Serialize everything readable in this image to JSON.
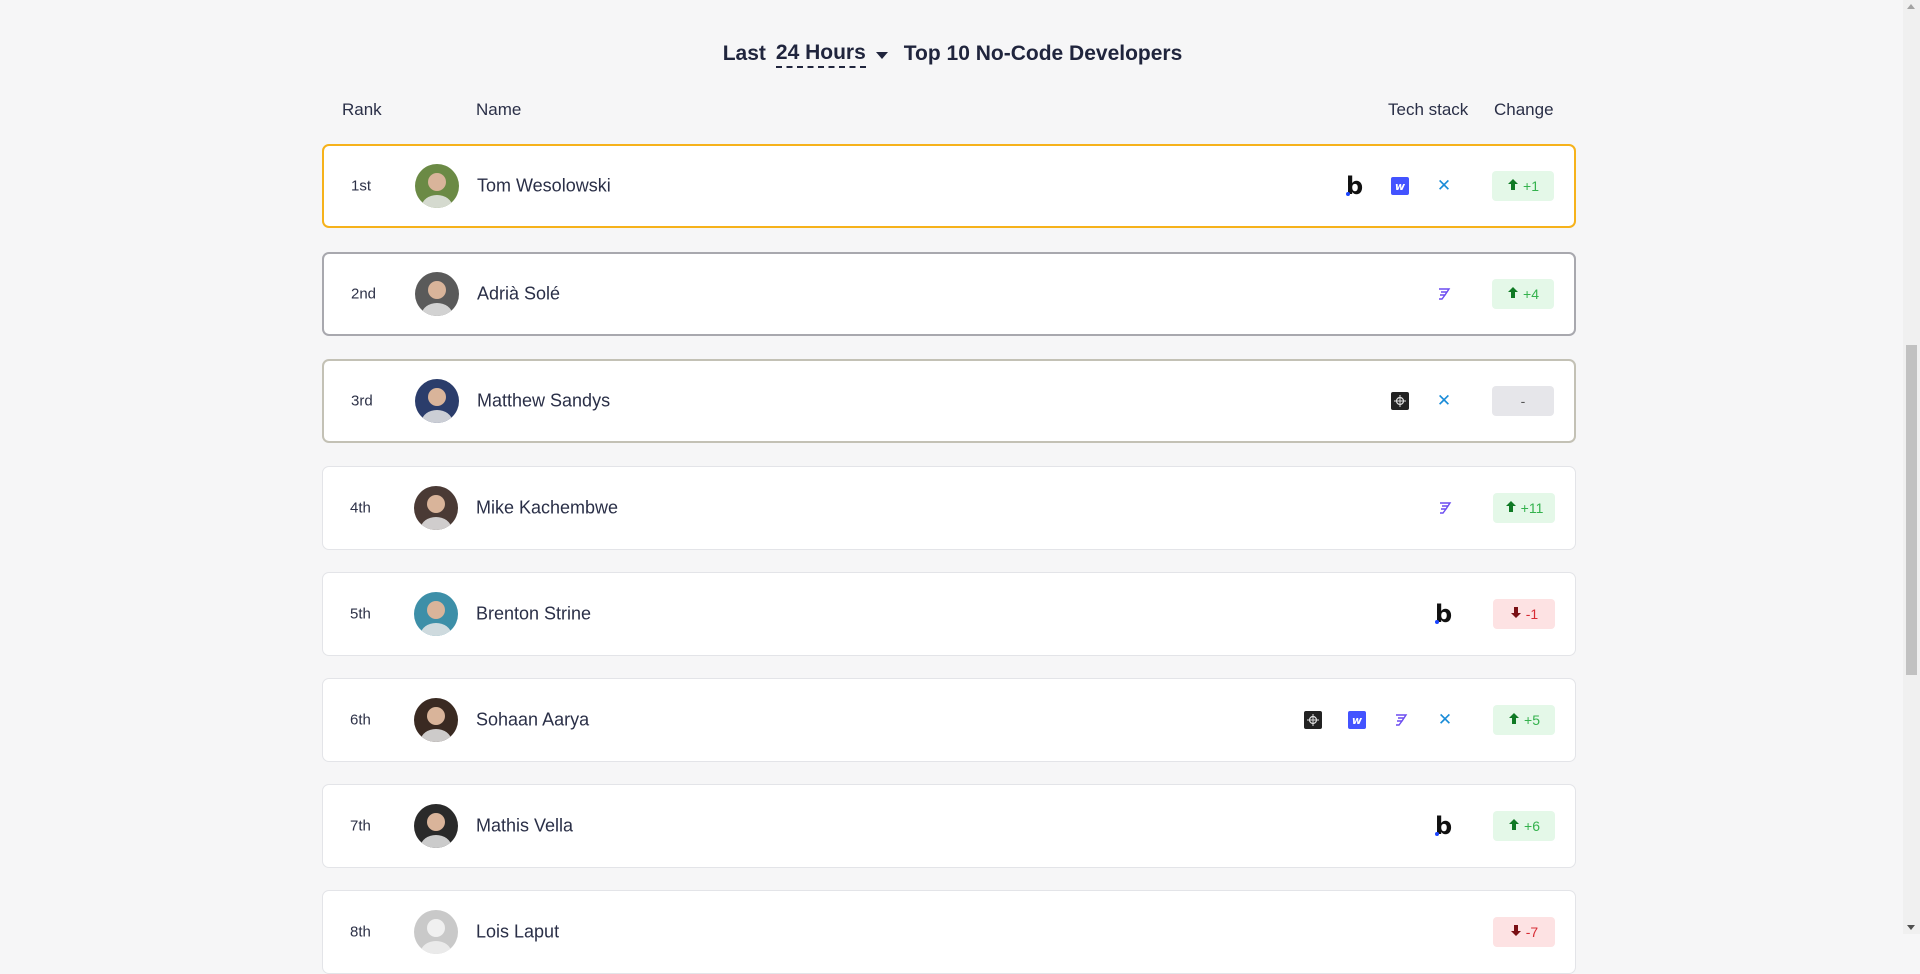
{
  "header": {
    "prefix": "Last",
    "period": "24 Hours",
    "title": "Top 10 No-Code Developers"
  },
  "columns": {
    "rank": "Rank",
    "name": "Name",
    "tech_stack": "Tech stack",
    "change": "Change"
  },
  "rows": [
    {
      "rank": "1st",
      "name": "Tom Wesolowski",
      "stack": [
        "bubble-icon",
        "webflow-icon",
        "xano-icon"
      ],
      "change": "+1",
      "dir": "up",
      "avatar_color": "#6b8a45"
    },
    {
      "rank": "2nd",
      "name": "Adrià Solé",
      "stack": [
        "flutterflow-icon"
      ],
      "change": "+4",
      "dir": "up",
      "avatar_color": "#5a5a5a"
    },
    {
      "rank": "3rd",
      "name": "Matthew Sandys",
      "stack": [
        "softr-icon",
        "xano-icon"
      ],
      "change": "-",
      "dir": "flat",
      "avatar_color": "#2b3d6b"
    },
    {
      "rank": "4th",
      "name": "Mike Kachembwe",
      "stack": [
        "flutterflow-icon"
      ],
      "change": "+11",
      "dir": "up",
      "avatar_color": "#4a3a35"
    },
    {
      "rank": "5th",
      "name": "Brenton Strine",
      "stack": [
        "bubble-icon"
      ],
      "change": "-1",
      "dir": "down",
      "avatar_color": "#3d8fa8"
    },
    {
      "rank": "6th",
      "name": "Sohaan Aarya",
      "stack": [
        "softr-icon",
        "webflow-icon",
        "flutterflow-icon",
        "xano-icon"
      ],
      "change": "+5",
      "dir": "up",
      "avatar_color": "#3a2a22"
    },
    {
      "rank": "7th",
      "name": "Mathis Vella",
      "stack": [
        "bubble-icon"
      ],
      "change": "+6",
      "dir": "up",
      "avatar_color": "#2a2a2a"
    },
    {
      "rank": "8th",
      "name": "Lois Laput",
      "stack": [],
      "change": "-7",
      "dir": "down",
      "avatar_color": "#c9c9c9"
    }
  ]
}
